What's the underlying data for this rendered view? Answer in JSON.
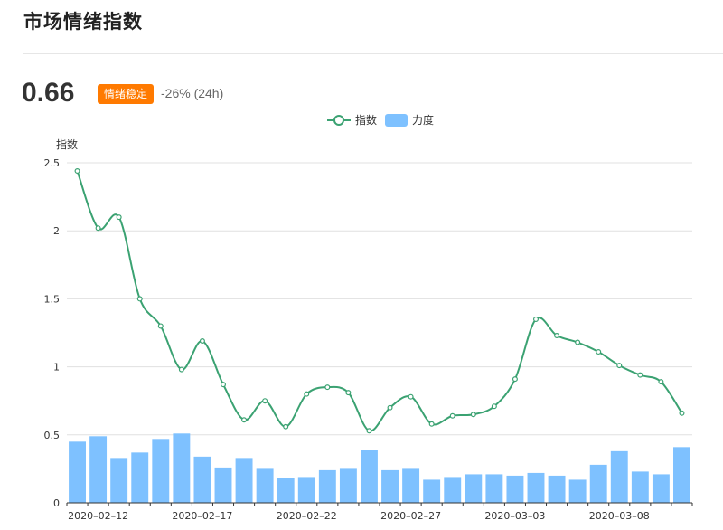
{
  "header": {
    "title": "市场情绪指数",
    "value": "0.66",
    "badge": "情绪稳定",
    "change": "-26% (24h)"
  },
  "colors": {
    "line": "#3ba272",
    "bar": "#7ec1ff",
    "badge": "#ff7a00"
  },
  "chart_data": {
    "type": "line+bar",
    "ylabel": "指数",
    "ylim": [
      0,
      2.5
    ],
    "yticks": [
      "0",
      "0.5",
      "1",
      "1.5",
      "2",
      "2.5"
    ],
    "grid": true,
    "legend_position": "top-center",
    "x": [
      "2020-02-11",
      "2020-02-12",
      "2020-02-13",
      "2020-02-14",
      "2020-02-15",
      "2020-02-16",
      "2020-02-17",
      "2020-02-18",
      "2020-02-19",
      "2020-02-20",
      "2020-02-21",
      "2020-02-22",
      "2020-02-23",
      "2020-02-24",
      "2020-02-25",
      "2020-02-26",
      "2020-02-27",
      "2020-02-28",
      "2020-02-29",
      "2020-03-01",
      "2020-03-02",
      "2020-03-03",
      "2020-03-04",
      "2020-03-05",
      "2020-03-06",
      "2020-03-07",
      "2020-03-08",
      "2020-03-09",
      "2020-03-10",
      "2020-03-11"
    ],
    "x_tick_labels": [
      {
        "index": 1,
        "label": "2020–02–12"
      },
      {
        "index": 6,
        "label": "2020–02–17"
      },
      {
        "index": 11,
        "label": "2020–02–22"
      },
      {
        "index": 16,
        "label": "2020–02–27"
      },
      {
        "index": 21,
        "label": "2020–03–03"
      },
      {
        "index": 26,
        "label": "2020–03–08"
      }
    ],
    "series": [
      {
        "name": "指数",
        "type": "line",
        "values": [
          2.44,
          2.02,
          2.1,
          1.5,
          1.3,
          0.98,
          1.19,
          0.87,
          0.61,
          0.75,
          0.56,
          0.8,
          0.85,
          0.81,
          0.53,
          0.7,
          0.78,
          0.58,
          0.64,
          0.65,
          0.71,
          0.91,
          1.35,
          1.23,
          1.18,
          1.11,
          1.01,
          0.94,
          0.89,
          0.66
        ]
      },
      {
        "name": "力度",
        "type": "bar",
        "values": [
          0.45,
          0.49,
          0.33,
          0.37,
          0.47,
          0.51,
          0.34,
          0.26,
          0.33,
          0.25,
          0.18,
          0.19,
          0.24,
          0.25,
          0.39,
          0.24,
          0.25,
          0.17,
          0.19,
          0.21,
          0.21,
          0.2,
          0.22,
          0.2,
          0.17,
          0.28,
          0.38,
          0.23,
          0.21,
          0.41
        ]
      }
    ]
  }
}
